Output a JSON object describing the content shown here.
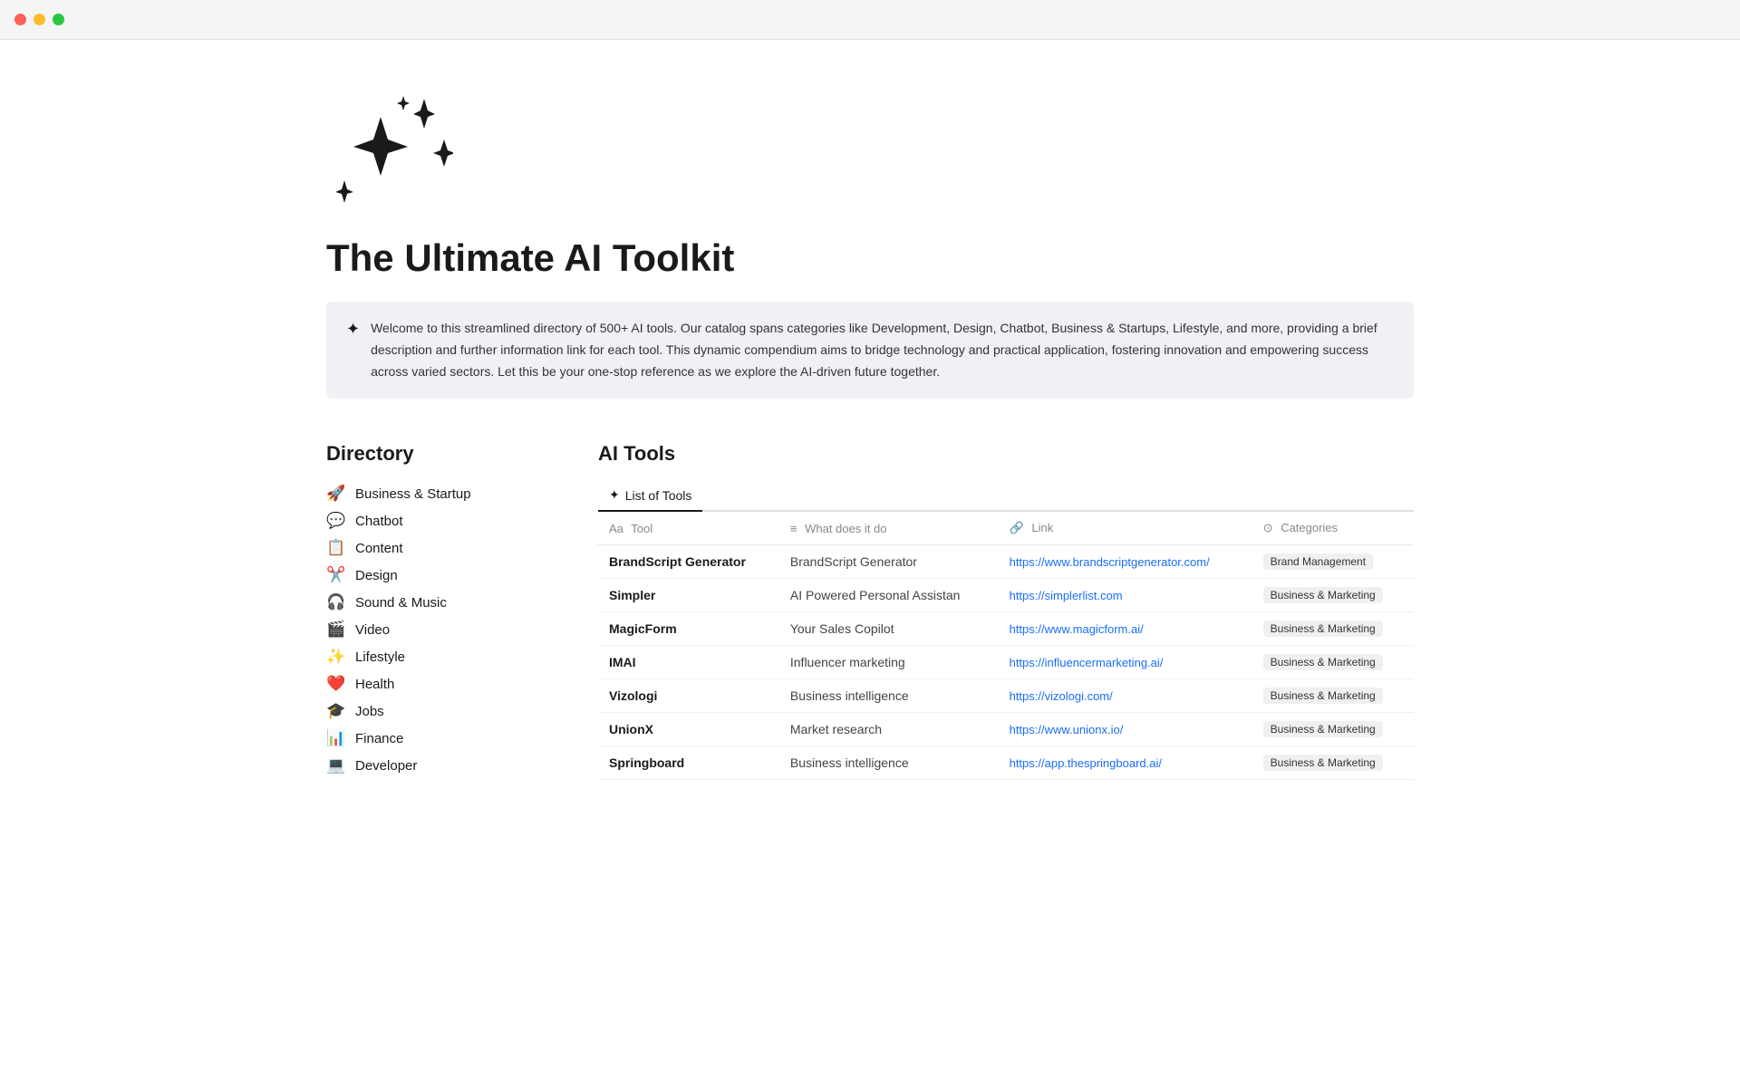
{
  "titlebar": {
    "btn_close_color": "#ff5f57",
    "btn_min_color": "#febc2e",
    "btn_max_color": "#28c840"
  },
  "page": {
    "title": "The Ultimate AI Toolkit",
    "callout_text": "Welcome to this streamlined directory of 500+ AI tools. Our catalog spans categories like Development, Design, Chatbot, Business & Startups, Lifestyle, and more, providing a brief description and further information link for each tool. This dynamic compendium aims to bridge technology and practical application, fostering innovation and empowering success across varied sectors. Let this be your one-stop reference as we explore the AI-driven future together."
  },
  "sidebar": {
    "title": "Directory",
    "items": [
      {
        "id": "business",
        "icon": "🚀",
        "label": "Business & Startup"
      },
      {
        "id": "chatbot",
        "icon": "💬",
        "label": "Chatbot"
      },
      {
        "id": "content",
        "icon": "📋",
        "label": "Content"
      },
      {
        "id": "design",
        "icon": "✂️",
        "label": "Design"
      },
      {
        "id": "sound-music",
        "icon": "🎧",
        "label": "Sound & Music"
      },
      {
        "id": "video",
        "icon": "🎬",
        "label": "Video"
      },
      {
        "id": "lifestyle",
        "icon": "✨",
        "label": "Lifestyle"
      },
      {
        "id": "health",
        "icon": "❤️",
        "label": "Health"
      },
      {
        "id": "jobs",
        "icon": "🎓",
        "label": "Jobs"
      },
      {
        "id": "finance",
        "icon": "📊",
        "label": "Finance"
      },
      {
        "id": "developer",
        "icon": "💻",
        "label": "Developer"
      }
    ]
  },
  "tools_section": {
    "title": "AI Tools",
    "tab_label": "List of Tools",
    "tab_icon": "✦",
    "columns": [
      {
        "id": "tool",
        "icon": "Aa",
        "label": "Tool"
      },
      {
        "id": "desc",
        "icon": "≡",
        "label": "What does it do"
      },
      {
        "id": "link",
        "icon": "🔗",
        "label": "Link"
      },
      {
        "id": "categories",
        "icon": "⊙",
        "label": "Categories"
      }
    ],
    "rows": [
      {
        "tool": "BrandScript Generator",
        "desc": "BrandScript Generator",
        "link": "https://www.brandscriptgenerator.com/",
        "category": "Brand Management"
      },
      {
        "tool": "Simpler",
        "desc": "AI Powered Personal Assistan",
        "link": "https://simplerlist.com",
        "category": "Business & Marketing"
      },
      {
        "tool": "MagicForm",
        "desc": "Your Sales Copilot",
        "link": "https://www.magicform.ai/",
        "category": "Business & Marketing"
      },
      {
        "tool": "IMAI",
        "desc": "Influencer marketing",
        "link": "https://influencermarketing.ai/",
        "category": "Business & Marketing"
      },
      {
        "tool": "Vizologi",
        "desc": "Business intelligence",
        "link": "https://vizologi.com/",
        "category": "Business & Marketing"
      },
      {
        "tool": "UnionX",
        "desc": "Market research",
        "link": "https://www.unionx.io/",
        "category": "Business & Marketing"
      },
      {
        "tool": "Springboard",
        "desc": "Business intelligence",
        "link": "https://app.thespringboard.ai/",
        "category": "Business & Marketing"
      }
    ]
  }
}
